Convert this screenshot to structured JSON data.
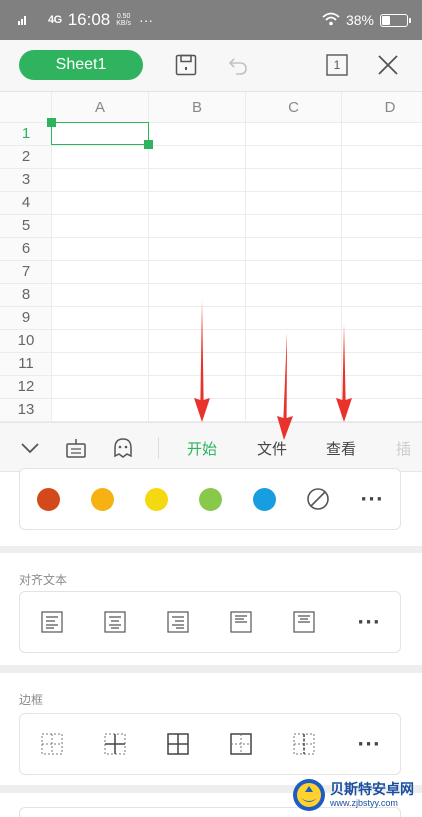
{
  "status_bar": {
    "signal": "4G",
    "time": "16:08",
    "speed_value": "0.50",
    "speed_unit": "KB/s",
    "dots": "···",
    "battery_percent": "38%",
    "battery_level": 0.38
  },
  "toolbar": {
    "sheet_name": "Sheet1",
    "save_icon": "save-icon",
    "undo_icon": "undo-icon",
    "sheet_count": "1",
    "close_icon": "close-icon"
  },
  "grid": {
    "columns": [
      "A",
      "B",
      "C",
      "D"
    ],
    "rows": [
      "1",
      "2",
      "3",
      "4",
      "5",
      "6",
      "7",
      "8",
      "9",
      "10",
      "11",
      "12",
      "13"
    ],
    "selected_cell": "A1",
    "accent": "#2fb35f"
  },
  "menu": {
    "collapse_icon": "chevron-down-icon",
    "keyboard_icon": "keyboard-icon",
    "assistant_icon": "assistant-icon",
    "tabs": [
      {
        "label": "开始",
        "active": true
      },
      {
        "label": "文件",
        "active": false
      },
      {
        "label": "查看",
        "active": false
      },
      {
        "label": "插",
        "active": false
      }
    ]
  },
  "panel": {
    "colors": {
      "swatches": [
        "#d4491a",
        "#f5b212",
        "#f5d90f",
        "#88c94c",
        "#169ee0"
      ],
      "no_color_icon": "no-color-icon",
      "more": "···"
    },
    "align": {
      "title": "对齐文本",
      "icons": [
        "align-left-icon",
        "align-center-icon",
        "align-right-icon",
        "align-top-left-icon",
        "align-middle-icon"
      ],
      "more": "···"
    },
    "border": {
      "title": "边框",
      "icons": [
        "border-none-icon",
        "border-inner-icon",
        "border-all-icon",
        "border-outer-icon",
        "border-dashed-icon"
      ],
      "more": "···"
    }
  },
  "watermark": {
    "name": "贝斯特安卓网",
    "url": "www.zjbstyy.com"
  },
  "annotation": {
    "arrow_color": "#e8322b"
  }
}
